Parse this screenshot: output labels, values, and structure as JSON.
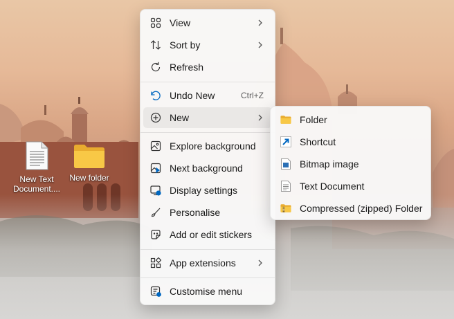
{
  "desktop": {
    "icons": [
      {
        "label": "New Text Document....",
        "icon": "text-file-icon"
      },
      {
        "label": "New folder",
        "icon": "folder-icon"
      }
    ]
  },
  "context_menu": {
    "items": [
      {
        "label": "View",
        "icon": "grid-view-icon",
        "has_submenu": true
      },
      {
        "label": "Sort by",
        "icon": "sort-icon",
        "has_submenu": true
      },
      {
        "label": "Refresh",
        "icon": "refresh-icon"
      },
      {
        "label": "Undo New",
        "icon": "undo-icon",
        "shortcut": "Ctrl+Z"
      },
      {
        "label": "New",
        "icon": "plus-circle-icon",
        "has_submenu": true,
        "highlighted": true
      },
      {
        "label": "Explore background",
        "icon": "image-icon"
      },
      {
        "label": "Next background",
        "icon": "next-background-icon"
      },
      {
        "label": "Display settings",
        "icon": "display-settings-icon"
      },
      {
        "label": "Personalise",
        "icon": "brush-icon"
      },
      {
        "label": "Add or edit stickers",
        "icon": "sticker-icon"
      },
      {
        "label": "App extensions",
        "icon": "apps-icon",
        "has_submenu": true
      },
      {
        "label": "Customise menu",
        "icon": "customise-menu-icon"
      }
    ]
  },
  "new_submenu": {
    "items": [
      {
        "label": "Folder",
        "icon": "folder-icon"
      },
      {
        "label": "Shortcut",
        "icon": "shortcut-icon"
      },
      {
        "label": "Bitmap image",
        "icon": "bitmap-icon"
      },
      {
        "label": "Text Document",
        "icon": "text-file-icon"
      },
      {
        "label": "Compressed (zipped) Folder",
        "icon": "zip-folder-icon"
      }
    ]
  },
  "colors": {
    "accent": "#0067c0",
    "folder_yellow": "#f8c846",
    "menu_bg": "#f9f9f9"
  }
}
